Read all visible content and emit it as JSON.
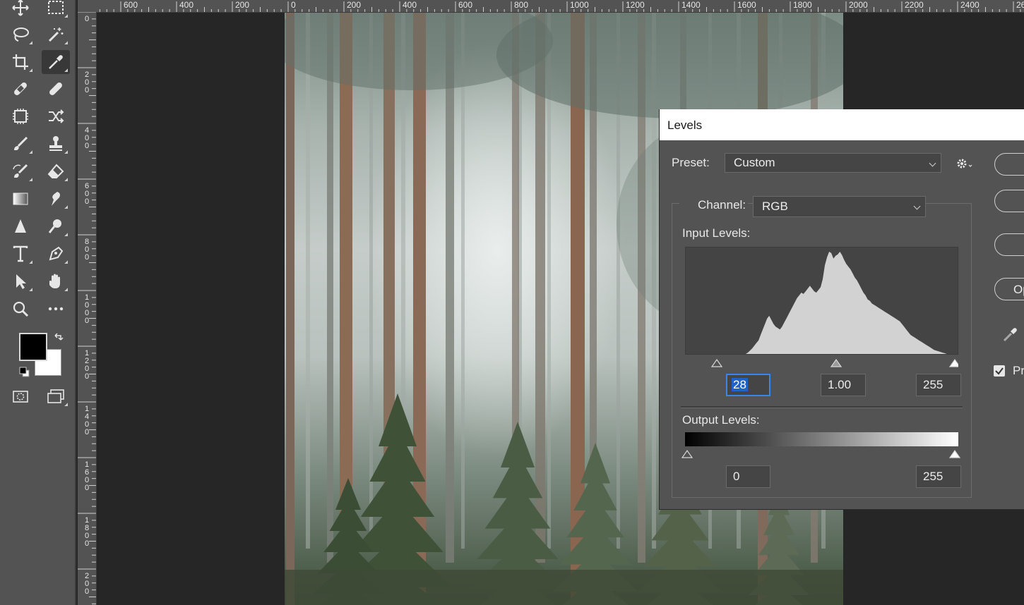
{
  "toolbar": {
    "tools": [
      {
        "name": "move-tool",
        "icon": "move-icon"
      },
      {
        "name": "marquee-tool",
        "icon": "rect-marquee-icon"
      },
      {
        "name": "lasso-tool",
        "icon": "lasso-icon"
      },
      {
        "name": "magic-wand-tool",
        "icon": "magic-wand-icon"
      },
      {
        "name": "crop-tool",
        "icon": "crop-icon"
      },
      {
        "name": "eyedropper-tool",
        "icon": "eyedropper-icon"
      },
      {
        "name": "spot-healing-tool",
        "icon": "bandage-icon"
      },
      {
        "name": "healing-brush-tool",
        "icon": "bandage-icon"
      },
      {
        "name": "patch-tool",
        "icon": "patch-icon"
      },
      {
        "name": "content-aware-move-tool",
        "icon": "shuffle-icon"
      },
      {
        "name": "brush-tool",
        "icon": "brush-icon"
      },
      {
        "name": "clone-stamp-tool",
        "icon": "stamp-icon"
      },
      {
        "name": "history-brush-tool",
        "icon": "history-brush-icon"
      },
      {
        "name": "eraser-tool",
        "icon": "eraser-icon"
      },
      {
        "name": "gradient-tool",
        "icon": "gradient-icon"
      },
      {
        "name": "smudge-tool",
        "icon": "smudge-icon"
      },
      {
        "name": "sharpen-tool",
        "icon": "triangle-icon"
      },
      {
        "name": "dodge-tool",
        "icon": "dodge-icon"
      },
      {
        "name": "type-tool",
        "icon": "type-icon"
      },
      {
        "name": "pen-tool",
        "icon": "pen-icon"
      },
      {
        "name": "path-selection-tool",
        "icon": "arrow-icon"
      },
      {
        "name": "hand-tool",
        "icon": "hand-icon"
      },
      {
        "name": "zoom-tool",
        "icon": "zoom-icon"
      },
      {
        "name": "more-tools",
        "icon": "more-icon"
      }
    ],
    "foreground_color": "#000000",
    "background_color": "#ffffff"
  },
  "ruler_top": [
    "600",
    "400",
    "200",
    "0",
    "200",
    "400",
    "600",
    "800",
    "1000",
    "1200",
    "1400",
    "1600",
    "1800",
    "2000",
    "2200",
    "2400",
    "26"
  ],
  "ruler_left": [
    "0",
    "200",
    "400",
    "600",
    "800",
    "1000",
    "1200",
    "1400",
    "1600",
    "1800",
    "200"
  ],
  "levels": {
    "title": "Levels",
    "preset_label": "Preset:",
    "preset_value": "Custom",
    "channel_label": "Channel:",
    "channel_value": "RGB",
    "input_label": "Input Levels:",
    "input_black": "28",
    "input_gamma": "1.00",
    "input_white": "255",
    "output_label": "Output Levels:",
    "output_black": "0",
    "output_white": "255",
    "side_buttons": [
      "",
      "",
      "",
      "Op"
    ],
    "preview_label": "Pr"
  },
  "histogram": {
    "bins": [
      0,
      0,
      0,
      0,
      0,
      0,
      0,
      0,
      0,
      0,
      0,
      0,
      0,
      0,
      0,
      0,
      0,
      0,
      0,
      0,
      0,
      0,
      0,
      0,
      0,
      0,
      0,
      0,
      0,
      2,
      5,
      8,
      12,
      16,
      20,
      28,
      36,
      44,
      52,
      56,
      50,
      44,
      40,
      38,
      36,
      40,
      46,
      52,
      58,
      64,
      70,
      76,
      82,
      86,
      90,
      88,
      92,
      96,
      100,
      96,
      92,
      90,
      94,
      98,
      110,
      130,
      142,
      150,
      148,
      140,
      144,
      146,
      150,
      145,
      138,
      132,
      128,
      124,
      118,
      112,
      108,
      102,
      96,
      90,
      86,
      80,
      78,
      74,
      72,
      70,
      68,
      66,
      64,
      62,
      60,
      58,
      56,
      54,
      52,
      50,
      48,
      44,
      40,
      36,
      32,
      28,
      26,
      24,
      22,
      20,
      18,
      16,
      14,
      12,
      10,
      8,
      6,
      5,
      4,
      3,
      2,
      1,
      0,
      0,
      0,
      0,
      0,
      0
    ]
  }
}
